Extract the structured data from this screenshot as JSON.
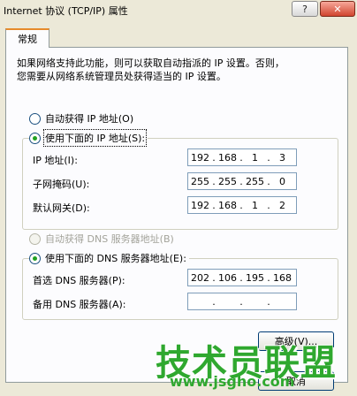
{
  "window": {
    "title": "Internet 协议 (TCP/IP) 属性",
    "help_label": "?",
    "close_label": "✕"
  },
  "tab": {
    "label": "常规"
  },
  "description": "如果网络支持此功能，则可以获取自动指派的 IP 设置。否则，\n您需要从网络系统管理员处获得适当的 IP 设置。",
  "ip_section": {
    "auto_label": "自动获得 IP 地址(O)",
    "manual_label": "使用下面的 IP 地址(S):",
    "selected": "manual",
    "fields": [
      {
        "label": "IP 地址(I):",
        "octets": [
          "192",
          "168",
          "1",
          "3"
        ]
      },
      {
        "label": "子网掩码(U):",
        "octets": [
          "255",
          "255",
          "255",
          "0"
        ]
      },
      {
        "label": "默认网关(D):",
        "octets": [
          "192",
          "168",
          "1",
          "2"
        ]
      }
    ]
  },
  "dns_section": {
    "auto_label": "自动获得 DNS 服务器地址(B)",
    "manual_label": "使用下面的 DNS 服务器地址(E):",
    "selected": "manual",
    "fields": [
      {
        "label": "首选 DNS 服务器(P):",
        "octets": [
          "202",
          "106",
          "195",
          "168"
        ]
      },
      {
        "label": "备用 DNS 服务器(A):",
        "octets": [
          "",
          "",
          "",
          ""
        ]
      }
    ]
  },
  "buttons": {
    "advanced_label": "高级(V)...",
    "cancel_label": "取消"
  },
  "watermark": {
    "main": "技术员联盟",
    "url": "www.jsgho.com"
  }
}
